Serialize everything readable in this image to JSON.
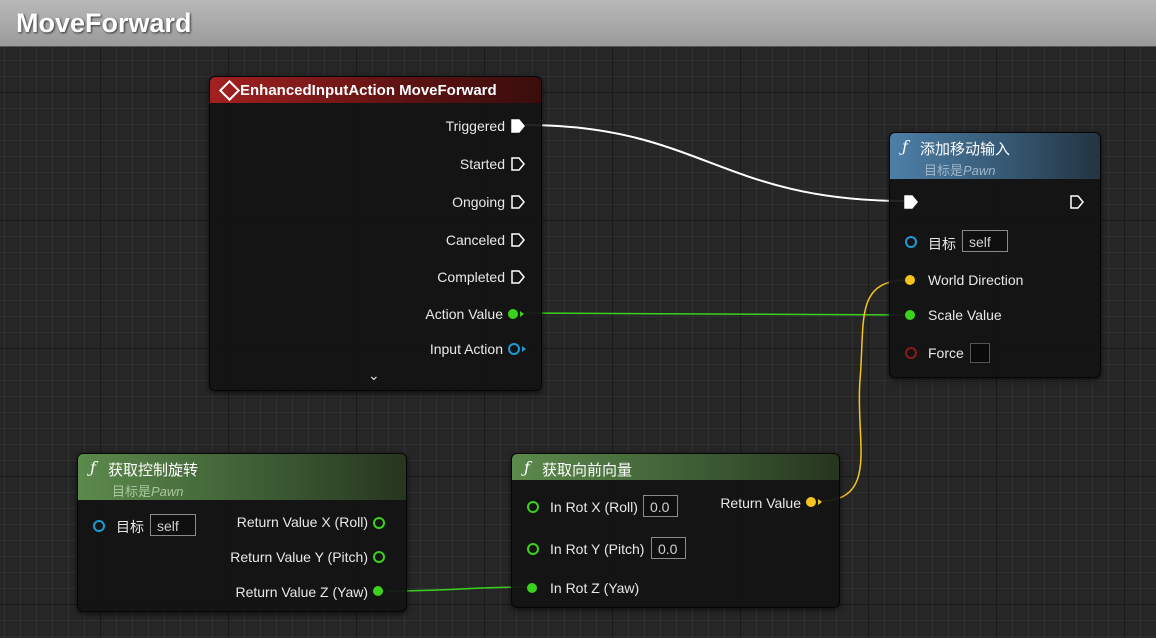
{
  "graph": {
    "title": "MoveForward"
  },
  "colors": {
    "exec": "#ffffff",
    "float": "#3bd21e",
    "vector": "#f5c31e",
    "object": "#1e9ad6",
    "struct_red": "#8a1a1a",
    "wire_float": "#3bd21e",
    "wire_vector": "#f5c31e"
  },
  "event_node": {
    "title": "EnhancedInputAction MoveForward",
    "icon": "event-diamond-icon",
    "outputs": [
      "Triggered",
      "Started",
      "Ongoing",
      "Canceled",
      "Completed"
    ],
    "action_value": "Action Value",
    "input_action": "Input Action",
    "expand_icon": "chevron-down-icon"
  },
  "add_movement": {
    "title": "添加移动输入",
    "subtitle_prefix": "目标是",
    "subtitle_class": "Pawn",
    "target_label": "目标",
    "target_value": "self",
    "world_direction": "World Direction",
    "scale_value": "Scale Value",
    "force": "Force"
  },
  "get_control_rotation": {
    "title": "获取控制旋转",
    "subtitle_prefix": "目标是",
    "subtitle_class": "Pawn",
    "target_label": "目标",
    "target_value": "self",
    "outputs": [
      "Return Value X (Roll)",
      "Return Value Y (Pitch)",
      "Return Value Z (Yaw)"
    ]
  },
  "get_forward_vector": {
    "title": "获取向前向量",
    "in_x": "In Rot X (Roll)",
    "in_x_value": "0.0",
    "in_y": "In Rot Y (Pitch)",
    "in_y_value": "0.0",
    "in_z": "In Rot Z (Yaw)",
    "return_value": "Return Value"
  }
}
